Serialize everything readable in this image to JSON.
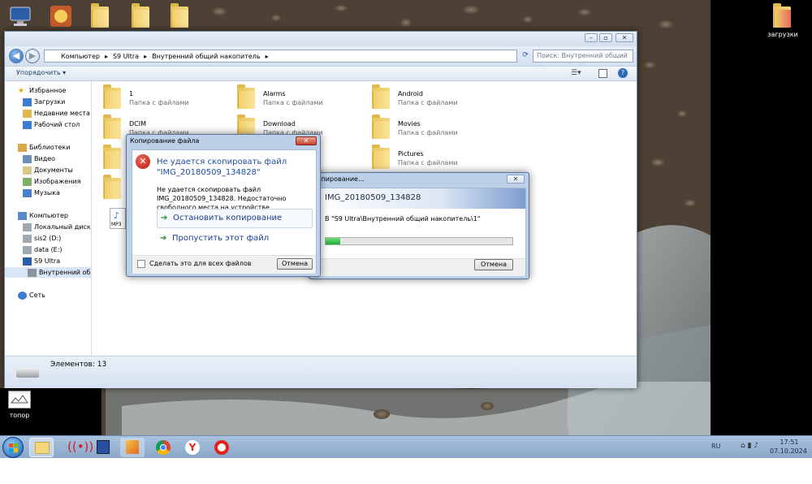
{
  "desktop": {
    "icons": [
      {
        "label": "",
        "name": "computer-icon"
      },
      {
        "label": "",
        "name": "app-icon"
      },
      {
        "label": "",
        "name": "folder-icon"
      },
      {
        "label": "",
        "name": "folder-icon"
      },
      {
        "label": "",
        "name": "folder-icon"
      },
      {
        "label": "загрузки",
        "name": "downloads-folder-icon"
      },
      {
        "label": "топор",
        "name": "image-file-icon"
      }
    ]
  },
  "explorer": {
    "breadcrumb": [
      "Компьютер",
      "S9 Ultra",
      "Внутренний общий накопитель"
    ],
    "search_placeholder": "Поиск: Внутренний общий н...",
    "toolbar": {
      "organize_label": "Упорядочить ▾"
    },
    "nav": {
      "favorites": "Избранное",
      "fav_items": [
        "Загрузки",
        "Недавние места",
        "Рабочий стол"
      ],
      "libraries": "Библиотеки",
      "lib_items": [
        "Видео",
        "Документы",
        "Изображения",
        "Музыка"
      ],
      "computer": "Компьютер",
      "comp_items": [
        "Локальный диск (C:)",
        "sis2 (D:)",
        "data (E:)",
        "S9 Ultra",
        "Внутренний общи"
      ],
      "network": "Сеть"
    },
    "folders": [
      {
        "name": "1",
        "desc": "Папка с файлами"
      },
      {
        "name": "Alarms",
        "desc": "Папка с файлами"
      },
      {
        "name": "Android",
        "desc": "Папка с файлами"
      },
      {
        "name": "DCIM",
        "desc": "Папка с файлами"
      },
      {
        "name": "Download",
        "desc": "Папка с файлами"
      },
      {
        "name": "Movies",
        "desc": "Папка с файлами"
      },
      {
        "name": "Pictures",
        "desc": "Папка с файлами"
      }
    ],
    "mp3_label": "MP3",
    "status": "Элементов: 13"
  },
  "copy_error": {
    "title": "Копирование файла",
    "heading": "Не удается скопировать файл \"IMG_20180509_134828\"",
    "message": "Не удается скопировать файл IMG_20180509_134828. Недостаточно свободного места на устройстве.",
    "option_stop": "Остановить копирование",
    "option_skip": "Пропустить этот файл",
    "checkbox_label": "Сделать это для всех файлов",
    "cancel_label": "Отмена"
  },
  "copy_progress": {
    "title": "Копирование...",
    "filename": "IMG_20180509_134828",
    "destination": "В \"S9 Ultra\\Внутренний общий накопитель\\1\"",
    "progress": 0.08,
    "cancel_label": "Отмена"
  },
  "taskbar": {
    "lang": "RU",
    "time": "17:51",
    "date": "07.10.2024"
  },
  "colors": {
    "heading_blue": "#1f4ea0",
    "option_green": "#1e8e2e",
    "progress_green": "#27c33a"
  }
}
